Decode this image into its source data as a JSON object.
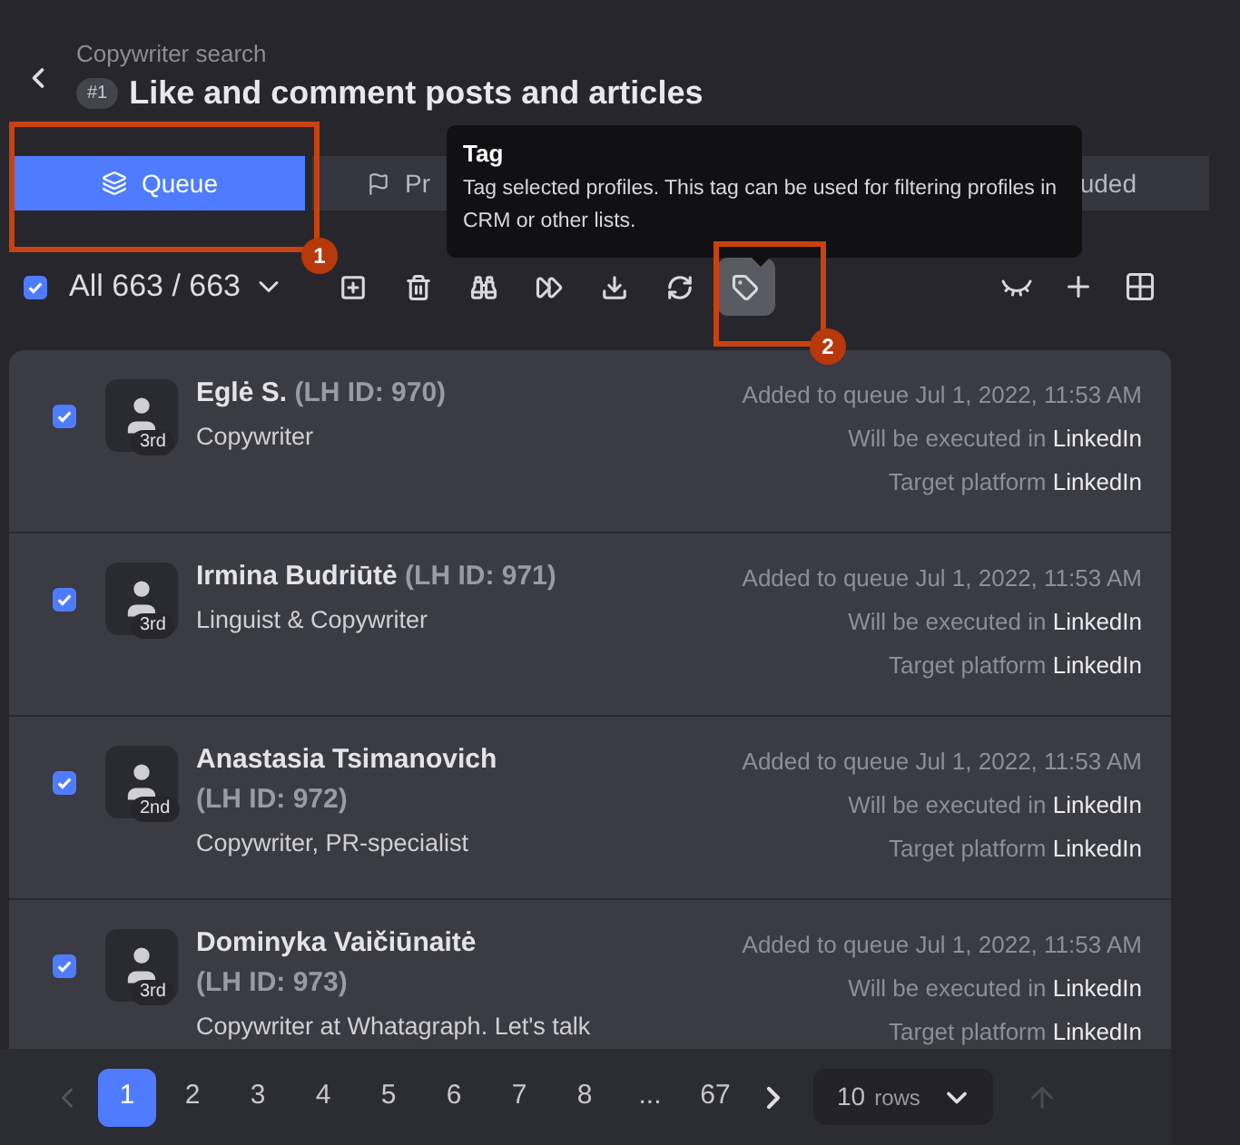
{
  "header": {
    "subtitle": "Copywriter search",
    "badge": "#1",
    "title": "Like and comment posts and articles"
  },
  "tabs": [
    {
      "label": "Queue",
      "selected": true
    },
    {
      "label": "Pr",
      "selected": false
    },
    {
      "label": "uded",
      "selected": false
    }
  ],
  "tooltip": {
    "title": "Tag",
    "text": "Tag selected profiles. This tag can be used for filtering profiles in CRM or other lists."
  },
  "toolbar": {
    "select_all_checked": true,
    "count": "All 663 / 663",
    "actions": [
      {
        "kind": "add",
        "selected": false
      },
      {
        "kind": "delete",
        "selected": false
      },
      {
        "kind": "binoculars",
        "selected": false
      },
      {
        "kind": "forward",
        "selected": false
      },
      {
        "kind": "download",
        "selected": false
      },
      {
        "kind": "refresh",
        "selected": false
      },
      {
        "kind": "tag",
        "selected": true
      }
    ]
  },
  "profiles": [
    {
      "checked": true,
      "name": "Eglė S.",
      "id": "(LH ID: 970)",
      "degree": "3rd",
      "headline": "Copywriter",
      "added": "Added to queue Jul 1, 2022, 11:53 AM",
      "executed_label": "Will be executed in",
      "executed": "LinkedIn",
      "target_label": "Target platform",
      "target": "LinkedIn"
    },
    {
      "checked": true,
      "name": "Irmina Budriūtė",
      "id": "(LH ID: 971)",
      "degree": "3rd",
      "headline": "Linguist & Copywriter",
      "added": "Added to queue Jul 1, 2022, 11:53 AM",
      "executed_label": "Will be executed in",
      "executed": "LinkedIn",
      "target_label": "Target platform",
      "target": "LinkedIn"
    },
    {
      "checked": true,
      "name": "Anastasia Tsimanovich",
      "id": "(LH ID: 972)",
      "degree": "2nd",
      "headline": "Copywriter, PR-specialist",
      "added": "Added to queue Jul 1, 2022, 11:53 AM",
      "executed_label": "Will be executed in",
      "executed": "LinkedIn",
      "target_label": "Target platform",
      "target": "LinkedIn"
    },
    {
      "checked": true,
      "name": "Dominyka Vaičiūnaitė",
      "id": "(LH ID: 973)",
      "degree": "3rd",
      "headline": "Copywriter at Whatagraph. Let's talk",
      "added": "Added to queue Jul 1, 2022, 11:53 AM",
      "executed_label": "Will be executed in",
      "executed": "LinkedIn",
      "target_label": "Target platform",
      "target": "LinkedIn"
    }
  ],
  "pagination": {
    "pages": [
      {
        "label": "1",
        "selected": true
      },
      {
        "label": "2",
        "selected": false
      },
      {
        "label": "3",
        "selected": false
      },
      {
        "label": "4",
        "selected": false
      },
      {
        "label": "5",
        "selected": false
      },
      {
        "label": "6",
        "selected": false
      },
      {
        "label": "7",
        "selected": false
      },
      {
        "label": "8",
        "selected": false
      },
      {
        "label": "...",
        "selected": false
      },
      {
        "label": "67",
        "selected": false
      }
    ],
    "rows_value": "10",
    "rows_label": "rows"
  },
  "annotations": [
    {
      "number": "1"
    },
    {
      "number": "2"
    }
  ]
}
